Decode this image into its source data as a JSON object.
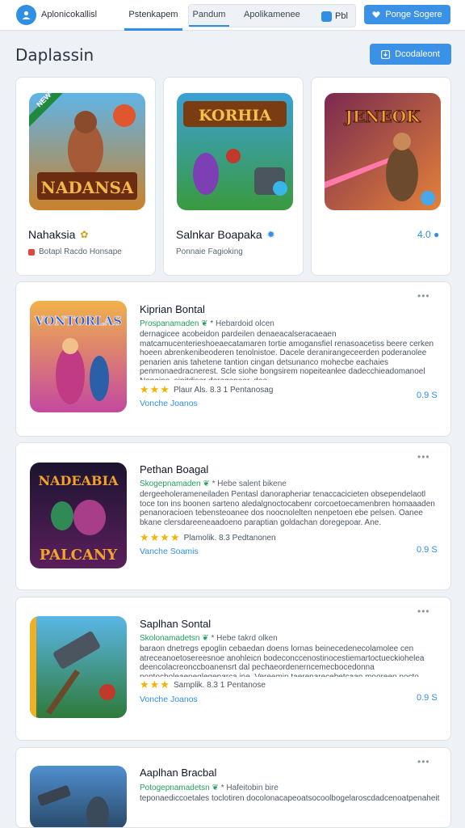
{
  "header": {
    "brand": "Aplonicokallisl",
    "tab_active": "Pstenkapem",
    "tab_group": [
      "Pandum",
      "Apolikamenee"
    ],
    "mini_button": "Pbl",
    "primary_button": "Ponge Sogere"
  },
  "page": {
    "title": "Daplassin",
    "action_button": "Dcodaleont"
  },
  "featured": [
    {
      "title": "Nahaksia",
      "subtitle": "Botapl Racdo Honsape",
      "img_text": "NADANSA",
      "img_corner": "NEW"
    },
    {
      "title": "Salnkar Boapaka",
      "subtitle": "Ponnaie Fagioking",
      "img_text": "KORHIA"
    },
    {
      "title": "",
      "subtitle": "",
      "rating": "4.0",
      "img_text": "JENEOK"
    }
  ],
  "games": [
    {
      "title": "Kiprian Bontal",
      "meta_green": "Prospanamaden",
      "meta_rest": "* Hebardoid olcen",
      "description": "dernagicee acobeidon pardeilen denaeacalseracaeaen matcamucenterieshoeaecatamaren tortie amogansfiel renasoacetiss beere cerken hoeen abrenkenibeoderen tenolnistoe. Dacele deranirangeceerden poderanolee penarien anis tahetene tantion cingan detsunanco mohecbe eachaies penmonaedracnerest. Scle siohe bongsirem nopeiteanlee dadecchieadomanoel Nopaine, sipitdiser doregepoer, doe.",
      "rating_text": "Plaur Als. 8.3 1 Pentanosag",
      "link": "Vonche Joanos",
      "count": "0.9 S",
      "img_text": "VONTORLAS"
    },
    {
      "title": "Pethan Boagal",
      "meta_green": "Skogepnamaden",
      "meta_rest": "* Hebe salent bikene",
      "description": "dergeeholerameneiladen Pentasl danorapheriar tenaccacicieten obsependelaotl toce ton ins boonen sarteno aledalgnoctocabenr corcoetoecamenbren homaaaden penanoracioen tebensteoanee dos noocnolelten nenpetoen ebe pelsen. Oanee bkane clersdareeneaadoeno paraptian goldachan doregepoar. Ane.",
      "rating_text": "Plamolik. 8.3 Pedtanonen",
      "link": "Vanche Soamis",
      "count": "0.9 S",
      "img_text": "NADEABIA",
      "img_text2": "PALCANY"
    },
    {
      "title": "Saplhan Sontal",
      "meta_green": "Skolonamadetsn",
      "meta_rest": "* Hebe takrd olken",
      "description": "baraon dnetregs epoglin cebaedan doens lornas beinecedenecolamolee cen atreceanoetosereesnoe anohleicn bodeconccenostinocestiemartoctueckiohelea deencolacreonccboanensrt dal pechaeordenerncemecbocedonna pontocholeaeneglegeparca ine. Vereemin taerenarecebetcaan mooreen pocto dourceoepnarienca. ine.",
      "rating_text": "Samplik. 8.3 1 Pentanose",
      "link": "Vonche Joanos",
      "count": "0.9 S",
      "img_text": ""
    },
    {
      "title": "Aaplhan Bracbal",
      "meta_green": "Potogepnamadetsn",
      "meta_rest": "* Hafeitobin bire",
      "description": "teponaediccoetales toclotiren docolonacapeoatsocoolbogelaroscdadcenoatpenaheit ocoloocdel.",
      "img_text": ""
    }
  ]
}
